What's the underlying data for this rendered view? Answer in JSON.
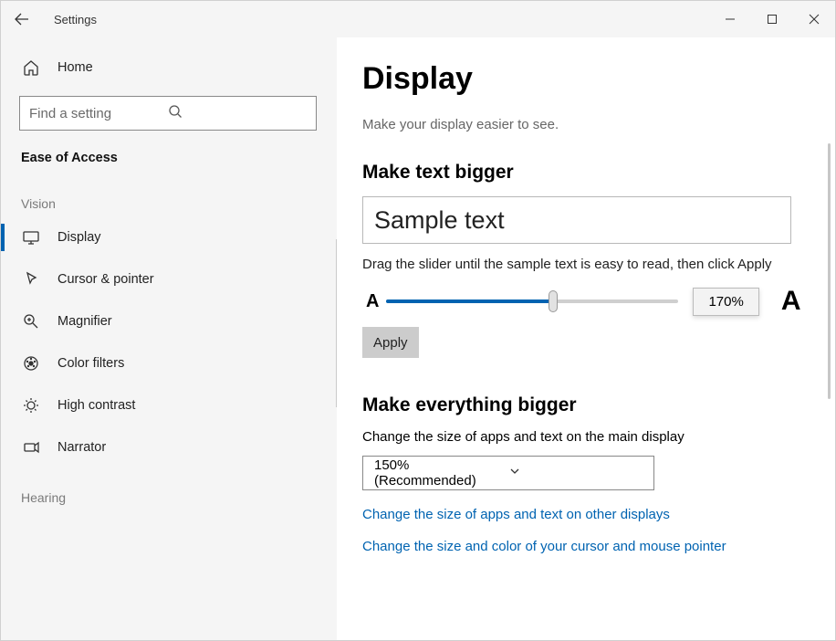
{
  "titlebar": {
    "title": "Settings"
  },
  "sidebar": {
    "home": "Home",
    "search_placeholder": "Find a setting",
    "category": "Ease of Access",
    "group_vision": "Vision",
    "group_hearing": "Hearing",
    "items": [
      {
        "label": "Display"
      },
      {
        "label": "Cursor & pointer"
      },
      {
        "label": "Magnifier"
      },
      {
        "label": "Color filters"
      },
      {
        "label": "High contrast"
      },
      {
        "label": "Narrator"
      }
    ]
  },
  "page": {
    "title": "Display",
    "subtitle": "Make your display easier to see.",
    "section_text": {
      "title": "Make text bigger",
      "sample": "Sample text",
      "desc": "Drag the slider until the sample text is easy to read, then click Apply",
      "value_label": "170%",
      "apply": "Apply",
      "letter_small": "A",
      "letter_large": "A"
    },
    "section_bigger": {
      "title": "Make everything bigger",
      "desc": "Change the size of apps and text on the main display",
      "dropdown_value": "150% (Recommended)",
      "link1": "Change the size of apps and text on other displays",
      "link2": "Change the size and color of your cursor and mouse pointer"
    }
  }
}
